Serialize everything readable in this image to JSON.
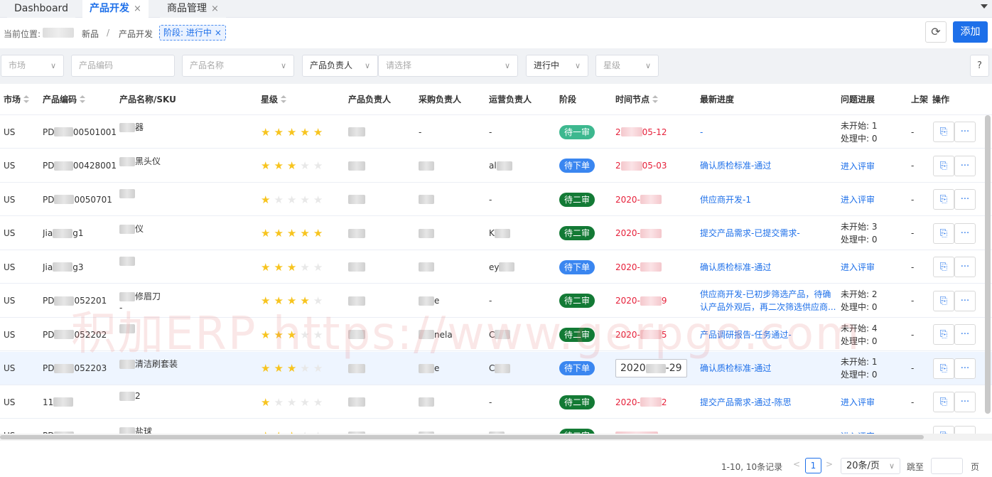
{
  "tabs": [
    {
      "label": "Dashboard",
      "closable": false,
      "active": false
    },
    {
      "label": "产品开发",
      "closable": true,
      "active": true
    },
    {
      "label": "商品管理",
      "closable": true,
      "active": false
    }
  ],
  "close_glyph": "×",
  "breadcrumb": {
    "label": "当前位置:",
    "items": [
      "新品",
      "产品开发"
    ],
    "separator": "/",
    "filter_chip": "阶段: 进行中"
  },
  "toolbar": {
    "add_label": "添加",
    "refresh_icon": "refresh-icon"
  },
  "filters": {
    "market": "市场",
    "product_code": "产品编码",
    "product_name": "产品名称",
    "owner_label": "产品负责人",
    "owner_placeholder": "请选择",
    "stage": "进行中",
    "star": "星级",
    "help": "?"
  },
  "columns": {
    "market": "市场",
    "code": "产品编码",
    "name": "产品名称/SKU",
    "star": "星级",
    "owner": "产品负责人",
    "purchase": "采购负责人",
    "ops_owner": "运营负责人",
    "stage": "阶段",
    "time": "时间节点",
    "progress": "最新进度",
    "issue": "问题进展",
    "listing": "上架",
    "actions": "操作"
  },
  "stage_colors": {
    "待一审": "#3db88f",
    "待下单": "#3a86f0",
    "待二审": "#137a35"
  },
  "rows": [
    {
      "market": "US",
      "code_a": "PD",
      "code_b": "00501001",
      "name": "器",
      "sku": "",
      "stars": 5,
      "purchase": "-",
      "ops": "-",
      "stage": "待一审",
      "time_a": "2",
      "time_b": "05-12",
      "time_red": true,
      "progress": "-",
      "issue_type": "counts",
      "issue_1": "未开始: 1",
      "issue_2": "处理中: 0",
      "listing": "-"
    },
    {
      "market": "US",
      "code_a": "PD",
      "code_b": "00428001",
      "name": "黑头仪",
      "sku": "",
      "stars": 3,
      "purchase": "",
      "ops": "al",
      "stage": "待下单",
      "time_a": "2",
      "time_b": "05-03",
      "time_red": true,
      "progress": "确认质检标准-通过",
      "issue_type": "link",
      "issue_1": "进入评审",
      "issue_2": "",
      "listing": "-"
    },
    {
      "market": "US",
      "code_a": "PD",
      "code_b": "0050701",
      "name": "",
      "sku": "",
      "stars": 1,
      "purchase": "",
      "ops": "-",
      "stage": "待二审",
      "time_a": "2020-",
      "time_b": "",
      "time_red": true,
      "progress": "供应商开发-1",
      "issue_type": "link",
      "issue_1": "进入评审",
      "issue_2": "",
      "listing": "-"
    },
    {
      "market": "US",
      "code_a": "Jia",
      "code_b": "g1",
      "name": "仪",
      "sku": "",
      "stars": 5,
      "purchase": "",
      "ops": "K",
      "stage": "待二审",
      "time_a": "2020-",
      "time_b": "",
      "time_red": true,
      "progress": "提交产品需求-已提交需求-",
      "issue_type": "counts",
      "issue_1": "未开始: 3",
      "issue_2": "处理中: 0",
      "listing": "-"
    },
    {
      "market": "US",
      "code_a": "Jia",
      "code_b": "g3",
      "name": "",
      "sku": "",
      "stars": 3,
      "purchase": "",
      "ops": "ey",
      "stage": "待下单",
      "time_a": "2020-",
      "time_b": "",
      "time_red": true,
      "progress": "确认质检标准-通过",
      "issue_type": "link",
      "issue_1": "进入评审",
      "issue_2": "",
      "listing": "-"
    },
    {
      "market": "US",
      "code_a": "PD",
      "code_b": "052201",
      "name": "修眉刀",
      "sku": "-",
      "stars": 4,
      "purchase": "e",
      "ops": "-",
      "stage": "待二审",
      "time_a": "2020-",
      "time_b": "9",
      "time_red": true,
      "progress": "供应商开发-已初步筛选产品，待确认产品外观后，再二次筛选供应商...",
      "issue_type": "counts",
      "issue_1": "未开始: 2",
      "issue_2": "处理中: 0",
      "listing": "-"
    },
    {
      "market": "US",
      "code_a": "PD",
      "code_b": "052202",
      "name": "",
      "sku": "",
      "stars": 3,
      "purchase": "nela",
      "ops": "C",
      "stage": "待二审",
      "time_a": "2020-",
      "time_b": "5",
      "time_red": true,
      "progress": "产品调研报告-任务通过-",
      "issue_type": "counts",
      "issue_1": "未开始: 4",
      "issue_2": "处理中: 0",
      "listing": "-"
    },
    {
      "market": "US",
      "code_a": "PD",
      "code_b": "052203",
      "name": "清洁刷套装",
      "sku": "",
      "stars": 3,
      "purchase": "e",
      "ops": "C",
      "stage": "待下单",
      "time_a": "2020",
      "time_b": "-29",
      "time_red": false,
      "progress": "确认质检标准-通过",
      "issue_type": "counts",
      "issue_1": "未开始: 1",
      "issue_2": "处理中: 0",
      "listing": "-"
    },
    {
      "market": "US",
      "code_a": "11",
      "code_b": "",
      "name": "2",
      "sku": "",
      "stars": 1,
      "purchase": "",
      "ops": "-",
      "stage": "待二审",
      "time_a": "2020-",
      "time_b": "2",
      "time_red": true,
      "progress": "提交产品需求-通过-陈思",
      "issue_type": "link",
      "issue_1": "进入评审",
      "issue_2": "",
      "listing": "-"
    },
    {
      "market": "US",
      "code_a": "PD",
      "code_b": "",
      "name": "盐球",
      "sku": "",
      "stars": 3,
      "purchase": "",
      "ops": "",
      "stage": "待二审",
      "time_a": "",
      "time_b": "",
      "time_red": true,
      "progress": "",
      "issue_type": "link",
      "issue_1": "进入评审",
      "issue_2": "",
      "listing": ""
    }
  ],
  "watermark": "积加ERP https://www.gerpgo.com",
  "pagination": {
    "total": "1-10, 10条记录",
    "current": "1",
    "page_size": "20条/页",
    "jump_label": "跳至",
    "page_label": "页"
  },
  "colors": {
    "accent": "#1d6fe9",
    "time_red": "#e6203a",
    "star": "#f7c41f"
  }
}
